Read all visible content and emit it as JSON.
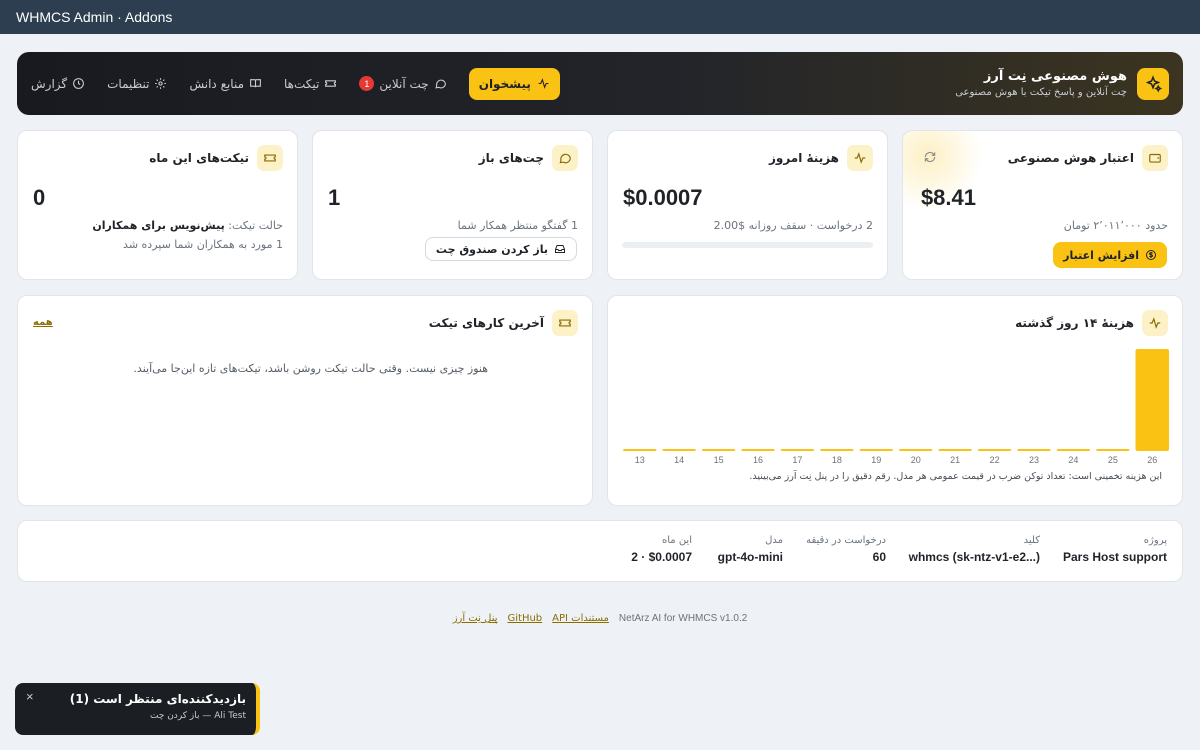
{
  "window": {
    "title": "WHMCS Admin · Addons"
  },
  "hero": {
    "title": "هوش مصنوعی نِت آرز",
    "subtitle": "چت آنلاین و پاسخ تیکت با هوش مصنوعی"
  },
  "nav": {
    "active": "پیشخوان",
    "chat": "چت آنلاین",
    "chat_badge": "1",
    "tickets": "تیکت‌ها",
    "knowledge": "منابع دانش",
    "settings": "تنظیمات",
    "report": "گزارش"
  },
  "cards": {
    "credit": {
      "title": "اعتبار هوش مصنوعی",
      "value": "$8.41",
      "note": "حدود ۲٬۰۱۱٬۰۰۰ تومان",
      "button": "افزایش اعتبار"
    },
    "today": {
      "title": "هزینهٔ امروز",
      "value": "$0.0007",
      "note": "2 درخواست · سقف روزانه $2.00",
      "progress": 0.0004
    },
    "chats": {
      "title": "چت‌های باز",
      "value": "1",
      "note": "1 گفتگو منتظر همکار شما",
      "button": "باز کردن صندوق چت"
    },
    "tickets": {
      "title": "تیکت‌های این ماه",
      "value": "0",
      "mode_label": "حالت تیکت:",
      "mode_value": "پیش‌نویس برای همکاران",
      "note": "1 مورد به همکاران شما سپرده شد"
    }
  },
  "cost_panel": {
    "title": "هزینهٔ ۱۴ روز گذشته",
    "footnote": "این هزینه تخمینی است: تعداد توکن ضرب در قیمت عمومی هر مدل. رقم دقیق را در پنل نِت آرز می‌بینید."
  },
  "ticket_panel": {
    "title": "آخرین کارهای تیکت",
    "all_link": "همه",
    "empty": "هنوز چیزی نیست. وقتی حالت تیکت روشن باشد، تیکت‌های تازه این‌جا می‌آیند."
  },
  "chart_data": {
    "type": "bar",
    "categories": [
      "13",
      "14",
      "15",
      "16",
      "17",
      "18",
      "19",
      "20",
      "21",
      "22",
      "23",
      "24",
      "25",
      "26"
    ],
    "values": [
      1e-05,
      1e-05,
      1e-05,
      1e-05,
      1e-05,
      1e-05,
      1e-05,
      1e-05,
      1e-05,
      1e-05,
      1e-05,
      1e-05,
      1e-05,
      0.0007
    ],
    "ylim": [
      0,
      0.0007
    ],
    "grid": false,
    "legend": "none",
    "color": "#fac213"
  },
  "info": {
    "project_label": "پروژه",
    "project_value": "Pars Host support",
    "key_label": "کلید",
    "key_value": "whmcs (sk-ntz-v1-e2...)",
    "rpm_label": "درخواست در دقیقه",
    "rpm_value": "60",
    "model_label": "مدل",
    "model_value": "gpt-4o-mini",
    "month_label": "این ماه",
    "month_value": "2 · $0.0007"
  },
  "footer": {
    "version": "NetArz AI for WHMCS v1.0.2",
    "api_docs": "مستندات API",
    "github": "GitHub",
    "panel": "پنل نِت آرز"
  },
  "toast": {
    "title": "بازدیدکننده‌ای منتظر است (1)",
    "subtitle": "Ali Test — باز کردن چت",
    "close": "×"
  },
  "colors": {
    "accent": "#fac213",
    "danger": "#e53935"
  }
}
